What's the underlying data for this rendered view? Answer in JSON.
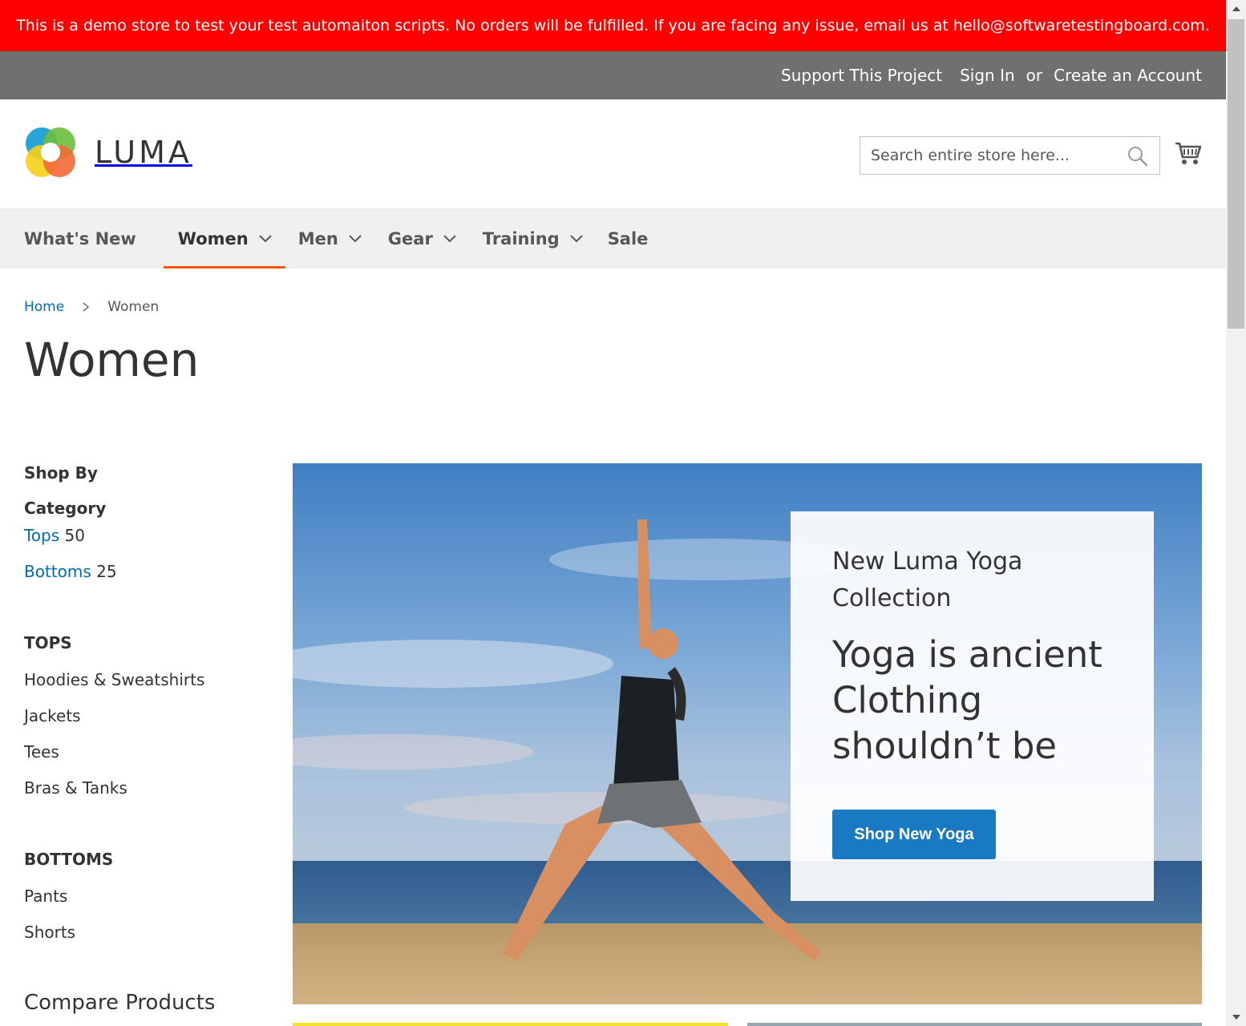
{
  "demo_banner": "This is a demo store to test your test automaiton scripts. No orders will be fulfilled. If you are facing any issue, email us at hello@softwaretestingboard.com.",
  "top_links": {
    "support": "Support This Project",
    "sign_in": "Sign In",
    "or": "or",
    "create_account": "Create an Account"
  },
  "header": {
    "logo_text": "LUMA",
    "search_placeholder": "Search entire store here...",
    "search_icon": "search-icon",
    "cart_icon": "cart-icon"
  },
  "nav": {
    "items": [
      {
        "label": "What's New",
        "has_dropdown": false
      },
      {
        "label": "Women",
        "has_dropdown": true,
        "active": true
      },
      {
        "label": "Men",
        "has_dropdown": true
      },
      {
        "label": "Gear",
        "has_dropdown": true
      },
      {
        "label": "Training",
        "has_dropdown": true
      },
      {
        "label": "Sale",
        "has_dropdown": false
      }
    ],
    "active_color": "#ff5501"
  },
  "breadcrumb": {
    "home": "Home",
    "current": "Women"
  },
  "page_title": "Women",
  "sidebar": {
    "shop_by": "Shop By",
    "category_title": "Category",
    "categories": [
      {
        "label": "Tops",
        "count": "50"
      },
      {
        "label": "Bottoms",
        "count": "25"
      }
    ],
    "tops": {
      "title": "TOPS",
      "links": [
        "Hoodies & Sweatshirts",
        "Jackets",
        "Tees",
        "Bras & Tanks"
      ]
    },
    "bottoms": {
      "title": "BOTTOMS",
      "links": [
        "Pants",
        "Shorts"
      ]
    },
    "compare_title": "Compare Products"
  },
  "hero": {
    "subtitle": "New Luma Yoga Collection",
    "title": "Yoga is ancient Clothing shouldn’t be",
    "button": "Shop New Yoga"
  },
  "colors": {
    "banner": "#ff0000",
    "top_bar": "#6e716e",
    "link": "#006bb4",
    "button": "#1979c3"
  }
}
